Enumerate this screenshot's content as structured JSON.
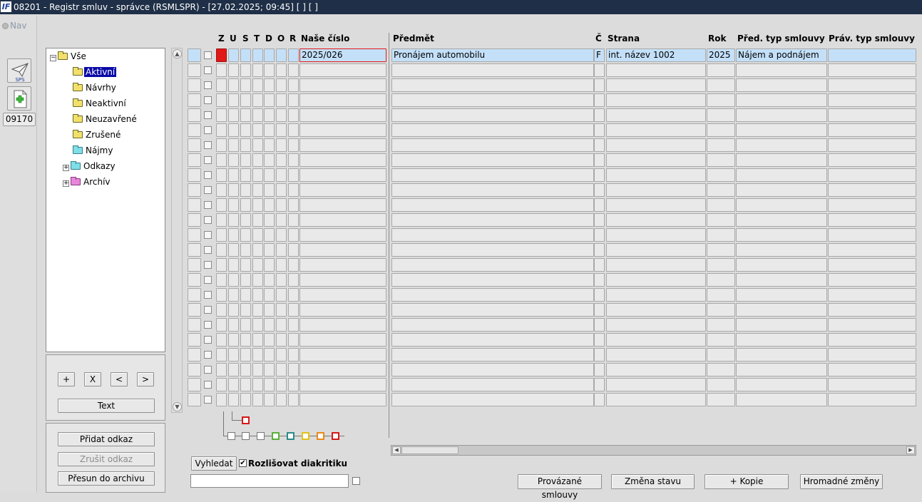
{
  "window": {
    "title": "08201 - Registr smluv - správce (RSMLSPR) - [27.02.2025; 09:45]  [ ]  [ ]",
    "logo": "IF"
  },
  "left": {
    "nav_label": "Nav",
    "sps_label": "SPS",
    "code_button": "09170"
  },
  "tree": {
    "items": [
      {
        "label": "Vše",
        "folder": "yellow",
        "expander": "−",
        "level": 0,
        "selected": false
      },
      {
        "label": "Aktivní",
        "folder": "yellow",
        "level": 1,
        "selected": true
      },
      {
        "label": "Návrhy",
        "folder": "yellow",
        "level": 1,
        "selected": false
      },
      {
        "label": "Neaktivní",
        "folder": "yellow",
        "level": 1,
        "selected": false
      },
      {
        "label": "Neuzavřené",
        "folder": "yellow",
        "level": 1,
        "selected": false
      },
      {
        "label": "Zrušené",
        "folder": "yellow",
        "level": 1,
        "selected": false
      },
      {
        "label": "Nájmy",
        "folder": "cyan",
        "level": 1,
        "selected": false
      },
      {
        "label": "Odkazy",
        "folder": "cyan",
        "expander": "+",
        "level": 1,
        "selected": false
      },
      {
        "label": "Archív",
        "folder": "pink",
        "expander": "+",
        "level": 1,
        "selected": false
      }
    ]
  },
  "nav_buttons": {
    "plus": "+",
    "x": "X",
    "prev": "<",
    "next": ">",
    "text": "Text"
  },
  "link_buttons": {
    "add": "Přidat odkaz",
    "remove": "Zrušit odkaz",
    "archive": "Přesun do archivu"
  },
  "grid": {
    "flag_headers": [
      "Z",
      "U",
      "S",
      "T",
      "D",
      "O",
      "R"
    ],
    "columns": {
      "cislo": "Naše číslo",
      "predmet": "Předmět",
      "c": "Č",
      "strana": "Strana",
      "rok": "Rok",
      "pred_typ": "Před. typ smlouvy",
      "prav_typ": "Práv. typ smlouvy"
    },
    "row1": {
      "cislo": "2025/026",
      "predmet": "Pronájem automobilu",
      "c": "F",
      "strana": "int. název 1002",
      "rok": "2025",
      "pred_typ": "Nájem a podnájem",
      "prav_typ": ""
    }
  },
  "search": {
    "button": "Vyhledat",
    "checkbox_label": "Rozlišovat diakritiku",
    "checkbox_checked": "✔"
  },
  "bottom_buttons": {
    "linked": "Provázané smlouvy",
    "state": "Změna stavu",
    "copy": "+ Kopie",
    "bulk": "Hromadné změny"
  },
  "colors": {
    "titlebar": "#1f2f47",
    "selected_row": "#c4e0f9",
    "tree_selection": "#0a0aa8",
    "flag_red": "#e01818"
  }
}
